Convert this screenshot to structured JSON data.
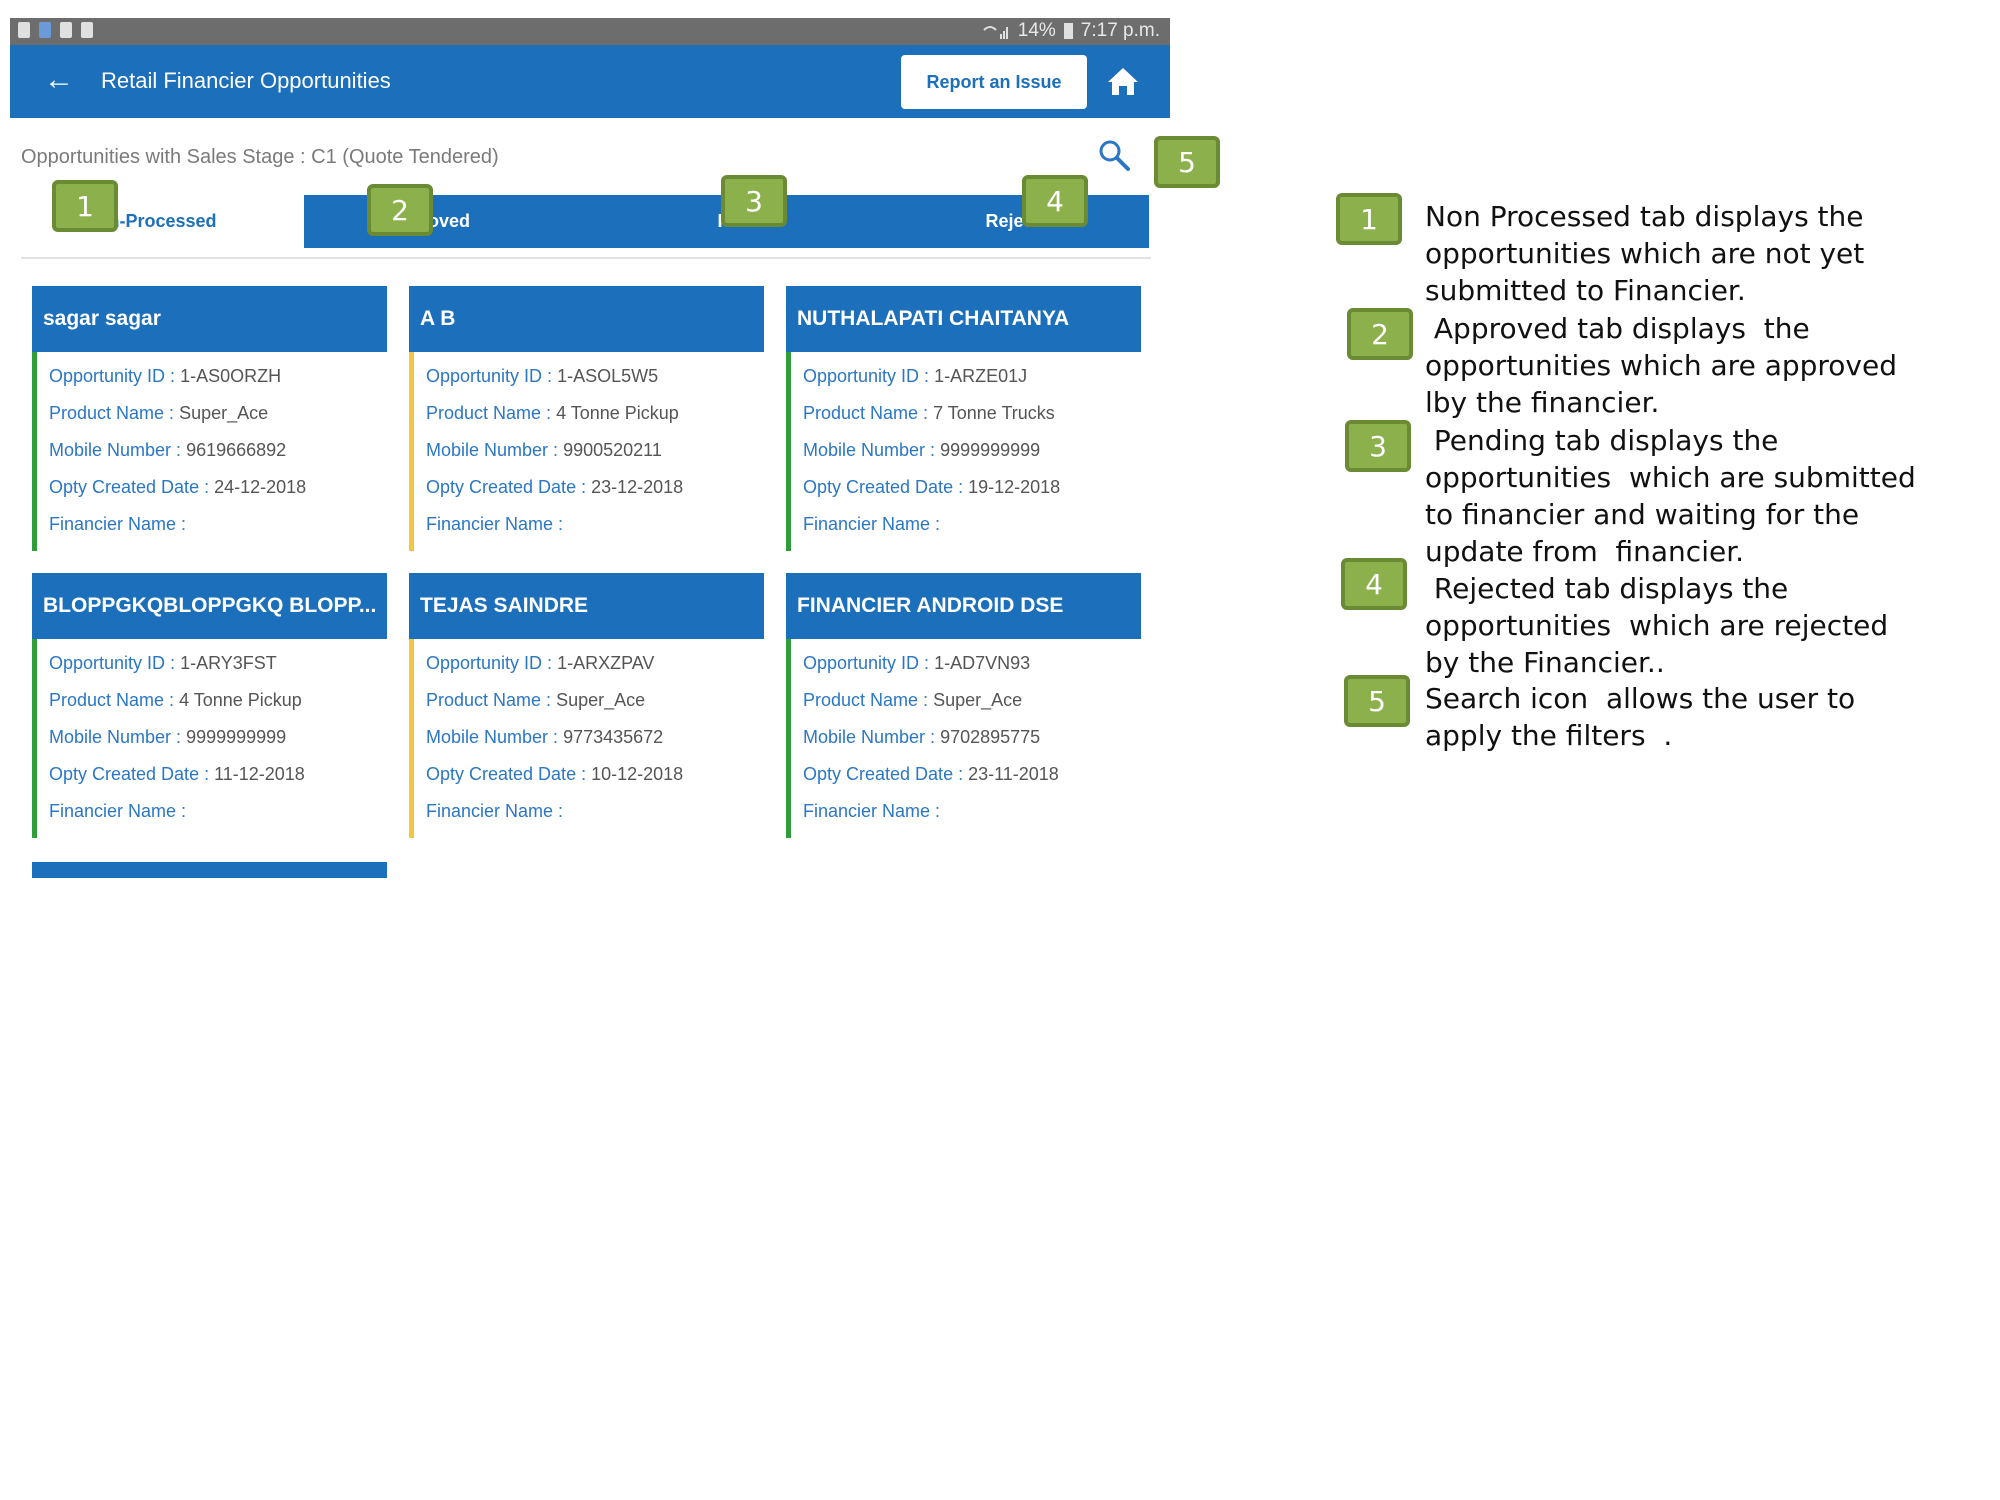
{
  "status_bar": {
    "battery": "14%",
    "time": "7:17 p.m."
  },
  "app_bar": {
    "title": "Retail Financier Opportunities",
    "report_button": "Report an Issue"
  },
  "subtitle": "Opportunities with Sales Stage : C1 (Quote Tendered)",
  "tabs": [
    {
      "label": "n-Processed",
      "active": true
    },
    {
      "label": "roved",
      "active": false
    },
    {
      "label": "Pe",
      "active": false
    },
    {
      "label": "Rejec",
      "active": false
    }
  ],
  "labels": {
    "opportunity_id": "Opportunity ID : ",
    "product_name": "Product Name : ",
    "mobile_number": "Mobile Number : ",
    "created_date": "Opty Created Date : ",
    "financier_name": "Financier Name : "
  },
  "cards": [
    {
      "name": "sagar sagar",
      "opportunity_id": "1-AS0ORZH",
      "product_name": "Super_Ace",
      "mobile_number": "9619666892",
      "created_date": "24-12-2018",
      "financier_name": "",
      "accent": "#2f9e3a"
    },
    {
      "name": "A B",
      "opportunity_id": "1-ASOL5W5",
      "product_name": "4 Tonne Pickup",
      "mobile_number": "9900520211",
      "created_date": "23-12-2018",
      "financier_name": "",
      "accent": "#f2c641"
    },
    {
      "name": "NUTHALAPATI CHAITANYA",
      "opportunity_id": "1-ARZE01J",
      "product_name": "7 Tonne Trucks",
      "mobile_number": "9999999999",
      "created_date": "19-12-2018",
      "financier_name": "",
      "accent": "#2f9e3a"
    },
    {
      "name": "BLOPPGKQBLOPPGKQ BLOPP...",
      "opportunity_id": "1-ARY3FST",
      "product_name": "4 Tonne Pickup",
      "mobile_number": "9999999999",
      "created_date": "11-12-2018",
      "financier_name": "",
      "accent": "#2f9e3a"
    },
    {
      "name": "TEJAS SAINDRE",
      "opportunity_id": "1-ARXZPAV",
      "product_name": "Super_Ace",
      "mobile_number": "9773435672",
      "created_date": "10-12-2018",
      "financier_name": "",
      "accent": "#f2c641"
    },
    {
      "name": "FINANCIER ANDROID DSE",
      "opportunity_id": "1-AD7VN93",
      "product_name": "Super_Ace",
      "mobile_number": "9702895775",
      "created_date": "23-11-2018",
      "financier_name": "",
      "accent": "#2f9e3a"
    }
  ],
  "callouts": [
    "1",
    "2",
    "3",
    "4",
    "5"
  ],
  "legend": [
    {
      "number": "1",
      "text": "Non Processed tab displays the opportunities which are not yet submitted to Financier."
    },
    {
      "number": "2",
      "text": " Approved tab displays  the opportunities which are approved lby the financier."
    },
    {
      "number": "3",
      "text": " Pending tab displays the opportunities  which are submitted to financier and waiting for the  update from  financier."
    },
    {
      "number": "4",
      "text": " Rejected tab displays the opportunities  which are rejected by the Financier.."
    },
    {
      "number": "5",
      "text": "Search icon  allows the user to apply the filters  ."
    }
  ],
  "colors": {
    "primary": "#1c6fba",
    "badge_fill": "#8cb04c",
    "badge_border": "#6a8a33",
    "accent_green": "#2f9e3a",
    "accent_yellow": "#f2c641"
  }
}
